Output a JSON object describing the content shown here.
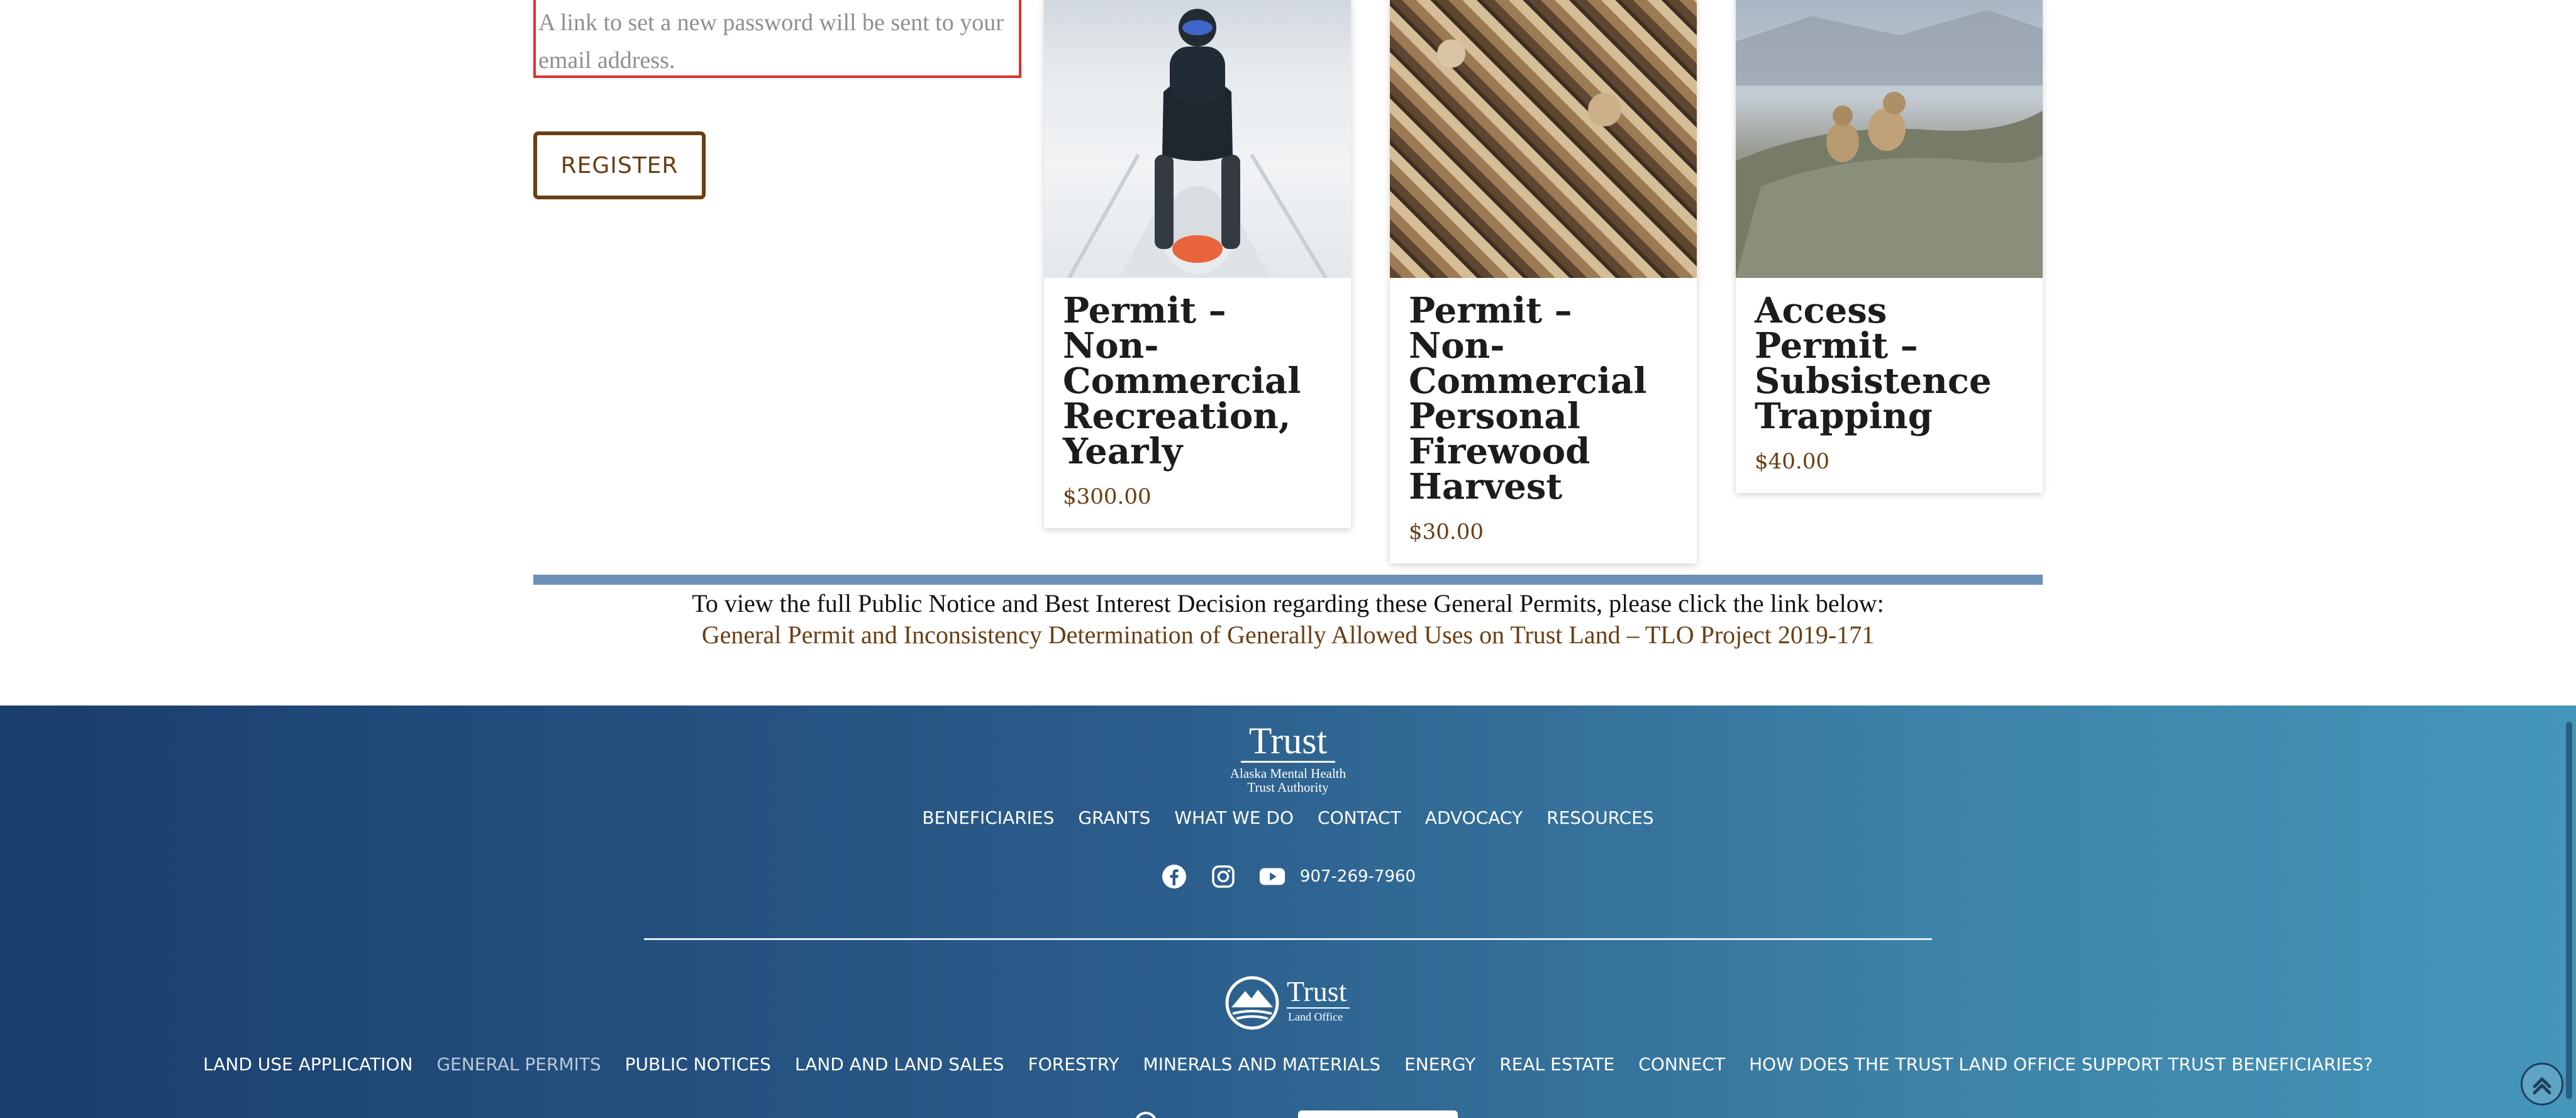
{
  "form": {
    "notice": "A link to set a new password will be sent to your email address.",
    "register_label": "REGISTER"
  },
  "products": [
    {
      "title": "Permit – Non-Commercial Recreation, Yearly",
      "price": "$300.00",
      "image": "snowmobile-rider"
    },
    {
      "title": "Permit – Non-Commercial Personal Firewood Harvest",
      "price": "$30.00",
      "image": "firewood-stack"
    },
    {
      "title": "Access Permit – Subsistence Trapping",
      "price": "$40.00",
      "image": "marmots-on-rock"
    }
  ],
  "general_permits": {
    "intro": "To view the full Public Notice and Best Interest Decision regarding these General Permits, please click the link below:",
    "link_text": "General Permit and Inconsistency Determination of Generally Allowed Uses on Trust Land – TLO Project 2019-171"
  },
  "footer": {
    "trust_logo": {
      "title": "Trust",
      "line1": "Alaska Mental Health",
      "line2": "Trust Authority"
    },
    "nav": [
      "BENEFICIARIES",
      "GRANTS",
      "WHAT WE DO",
      "CONTACT",
      "ADVOCACY",
      "RESOURCES"
    ],
    "social": [
      "facebook-icon",
      "instagram-icon",
      "youtube-icon"
    ],
    "phone": "907-269-7960",
    "tlo_logo": {
      "title": "Trust",
      "subtitle": "Land Office"
    },
    "tlo_nav": [
      {
        "label": "LAND USE APPLICATION",
        "active": false
      },
      {
        "label": "GENERAL PERMITS",
        "active": true
      },
      {
        "label": "PUBLIC NOTICES",
        "active": false
      },
      {
        "label": "LAND AND LAND SALES",
        "active": false
      },
      {
        "label": "FORESTRY",
        "active": false
      },
      {
        "label": "MINERALS AND MATERIALS",
        "active": false
      },
      {
        "label": "ENERGY",
        "active": false
      },
      {
        "label": "REAL ESTATE",
        "active": false
      },
      {
        "label": "CONNECT",
        "active": false
      },
      {
        "label": "HOW DOES THE TRUST LAND OFFICE SUPPORT TRUST BENEFICIARIES?",
        "active": false
      }
    ]
  },
  "colors": {
    "accent_brown": "#6b3e12",
    "divider_blue": "#6e8fb7",
    "footer_start": "#1a3e6e",
    "footer_end": "#4596bb",
    "error_border": "#e0302f"
  }
}
